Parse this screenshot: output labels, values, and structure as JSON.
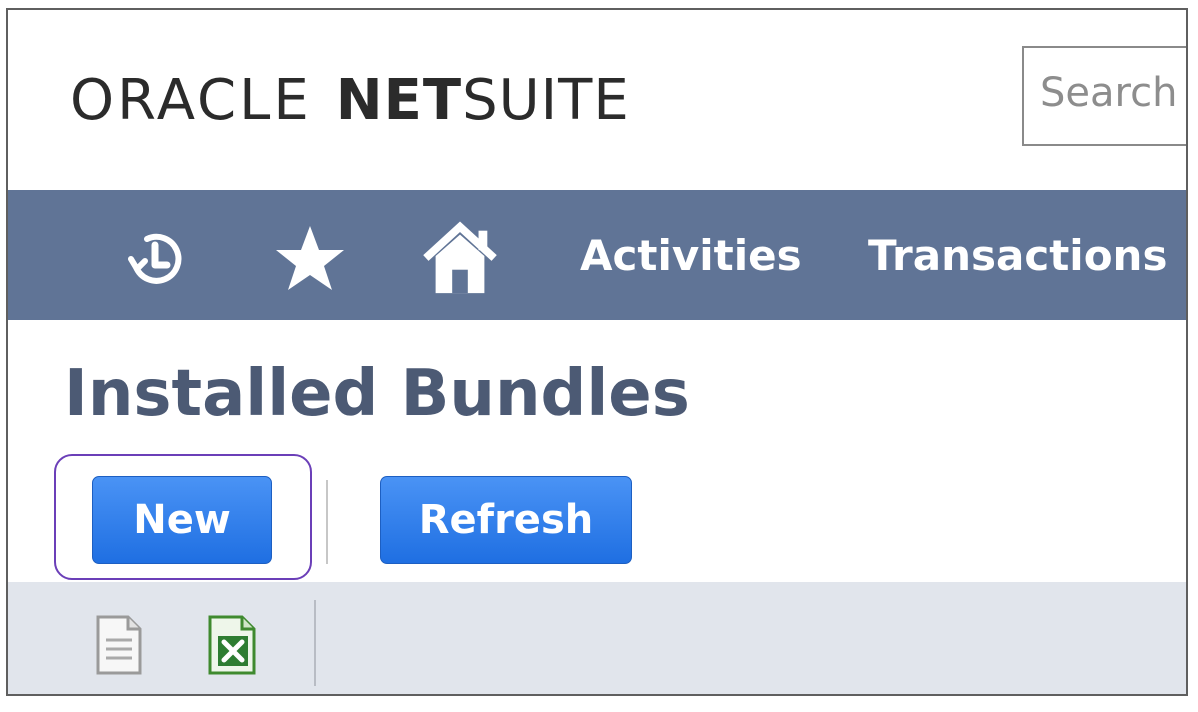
{
  "header": {
    "logo": {
      "oracle": "ORACLE",
      "net": "NET",
      "suite": "SUITE"
    },
    "search": {
      "placeholder": "Search"
    }
  },
  "navbar": {
    "icons": [
      "recent-records-icon",
      "favorites-star-icon",
      "home-icon"
    ],
    "items": [
      {
        "label": "Activities"
      },
      {
        "label": "Transactions"
      }
    ],
    "color": "#607496"
  },
  "page": {
    "title": "Installed Bundles",
    "title_color": "#4c5a74"
  },
  "buttons": {
    "new_label": "New",
    "refresh_label": "Refresh",
    "button_color": "#2f7ff0",
    "highlight_color": "#6b3fb8"
  },
  "list_toolbar": {
    "icons": [
      "print-document-icon",
      "export-excel-icon"
    ]
  }
}
